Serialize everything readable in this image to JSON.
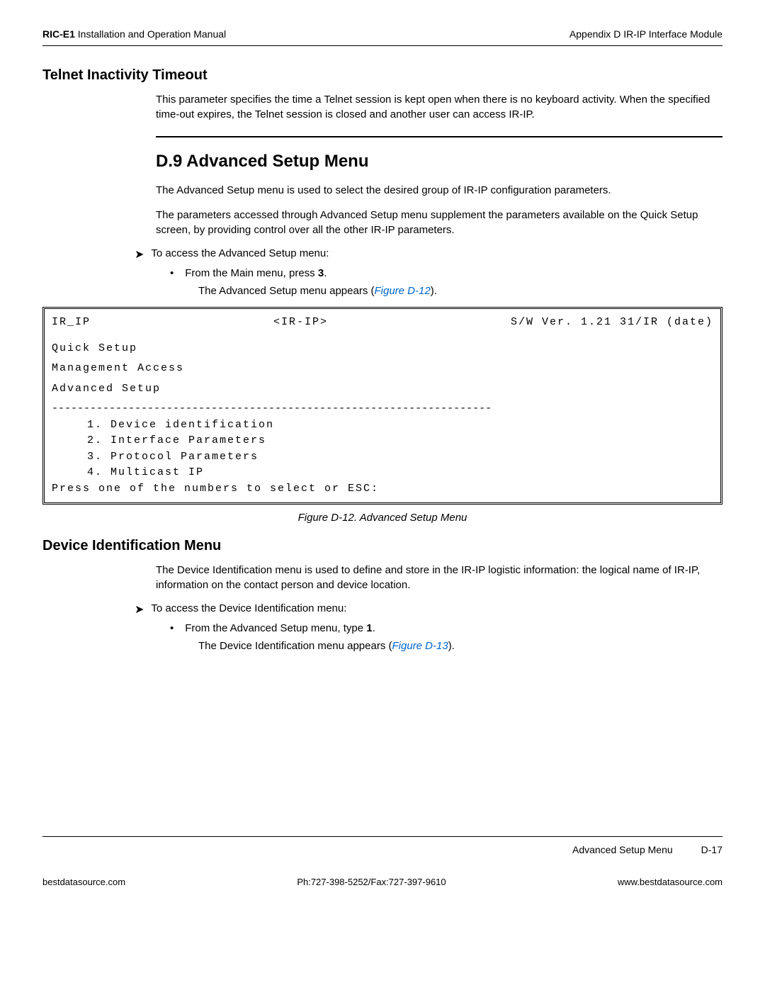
{
  "header": {
    "left_bold": "RIC-E1",
    "left_normal": " Installation and Operation Manual",
    "right": "Appendix D  IR-IP Interface Module"
  },
  "section1": {
    "heading": "Telnet Inactivity Timeout",
    "paragraph": "This parameter specifies the time a Telnet session is kept open when there is no keyboard activity. When the specified time-out expires, the Telnet session is closed and another user can access IR-IP."
  },
  "section2": {
    "heading": "D.9 Advanced Setup Menu",
    "para1": "The Advanced Setup menu is used to select the desired group of IR-IP configuration parameters.",
    "para2": "The parameters accessed through Advanced Setup menu supplement the parameters available on the Quick Setup screen, by providing control over all the other IR-IP parameters.",
    "arrow_text": "To access the Advanced Setup menu:",
    "bullet_text_pre": "From the Main menu, press ",
    "bullet_text_bold": "3",
    "bullet_text_post": ".",
    "result_text_pre": "The Advanced Setup menu appears (",
    "result_link": "Figure D-12",
    "result_text_post": ")."
  },
  "terminal": {
    "top_left": "IR_IP",
    "top_center": "<IR-IP>",
    "top_right": "S/W Ver. 1.21 31/IR (date)",
    "line1": "Quick Setup",
    "line2": "Management Access",
    "line3": "Advanced Setup",
    "divider": "---------------------------------------------------------------------",
    "opt1": "1. Device identification",
    "opt2": "2. Interface Parameters",
    "opt3": "3. Protocol Parameters",
    "opt4": "4. Multicast IP",
    "prompt": "Press one of the numbers to select or ESC:"
  },
  "figure_caption": "Figure D-12.  Advanced Setup Menu",
  "section3": {
    "heading": "Device Identification Menu",
    "para1": "The Device Identification menu is used to define and store in the IR-IP logistic information: the logical name of IR-IP, information on the contact person and device location.",
    "arrow_text": "To access the Device Identification menu:",
    "bullet_text_pre": "From the Advanced Setup menu, type ",
    "bullet_text_bold": "1",
    "bullet_text_post": ".",
    "result_text_pre": "The Device Identification menu appears (",
    "result_link": "Figure D-13",
    "result_text_post": ")."
  },
  "footer_top": {
    "label": "Advanced Setup Menu",
    "page": "D-17"
  },
  "footer_bottom": {
    "left": "bestdatasource.com",
    "center": "Ph:727-398-5252/Fax:727-397-9610",
    "right": "www.bestdatasource.com"
  }
}
